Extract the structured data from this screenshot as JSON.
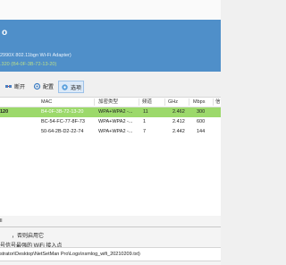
{
  "header": {
    "title": "o",
    "adapter": "2990X 802.11bgn Wi-Fi Adapter)",
    "mac_info": ".320 (B4-0F-3B-72-13-20)"
  },
  "toolbar": {
    "disconnect_label": "断开",
    "config_label": "配置",
    "options_label": "选项"
  },
  "table": {
    "columns": [
      "MAC",
      "加密类型",
      "频道",
      "GHz",
      "Mbps",
      "信"
    ],
    "rows": [
      {
        "ssid": "120",
        "mac": "B4-0F-3B-72-13-20",
        "encryption": "WPA+WPA2 -...",
        "channel": "11",
        "ghz": "2.462",
        "mbps": "300",
        "selected": true
      },
      {
        "ssid": "",
        "mac": "BC-54-FC-77-8F-73",
        "encryption": "WPA+WPA2 -...",
        "channel": "1",
        "ghz": "2.412",
        "mbps": "600",
        "selected": false
      },
      {
        "ssid": "",
        "mac": "50-64-2B-D2-22-74",
        "encryption": "WPA+WPA2 -...",
        "channel": "7",
        "ghz": "2.442",
        "mbps": "144",
        "selected": false
      }
    ]
  },
  "status": {
    "line1": "ll",
    "option1": "，否则启用它",
    "option2": "号信号最强的 WiFi 接入点",
    "path": "strator\\Desktop\\NetSetMan Pro\\Logs\\nsmlog_wifi_20210209.txt)"
  },
  "colors": {
    "header_bg": "#4f8fc9",
    "selected_row": "#9cd96b",
    "accent_green": "#b9dd8a"
  }
}
